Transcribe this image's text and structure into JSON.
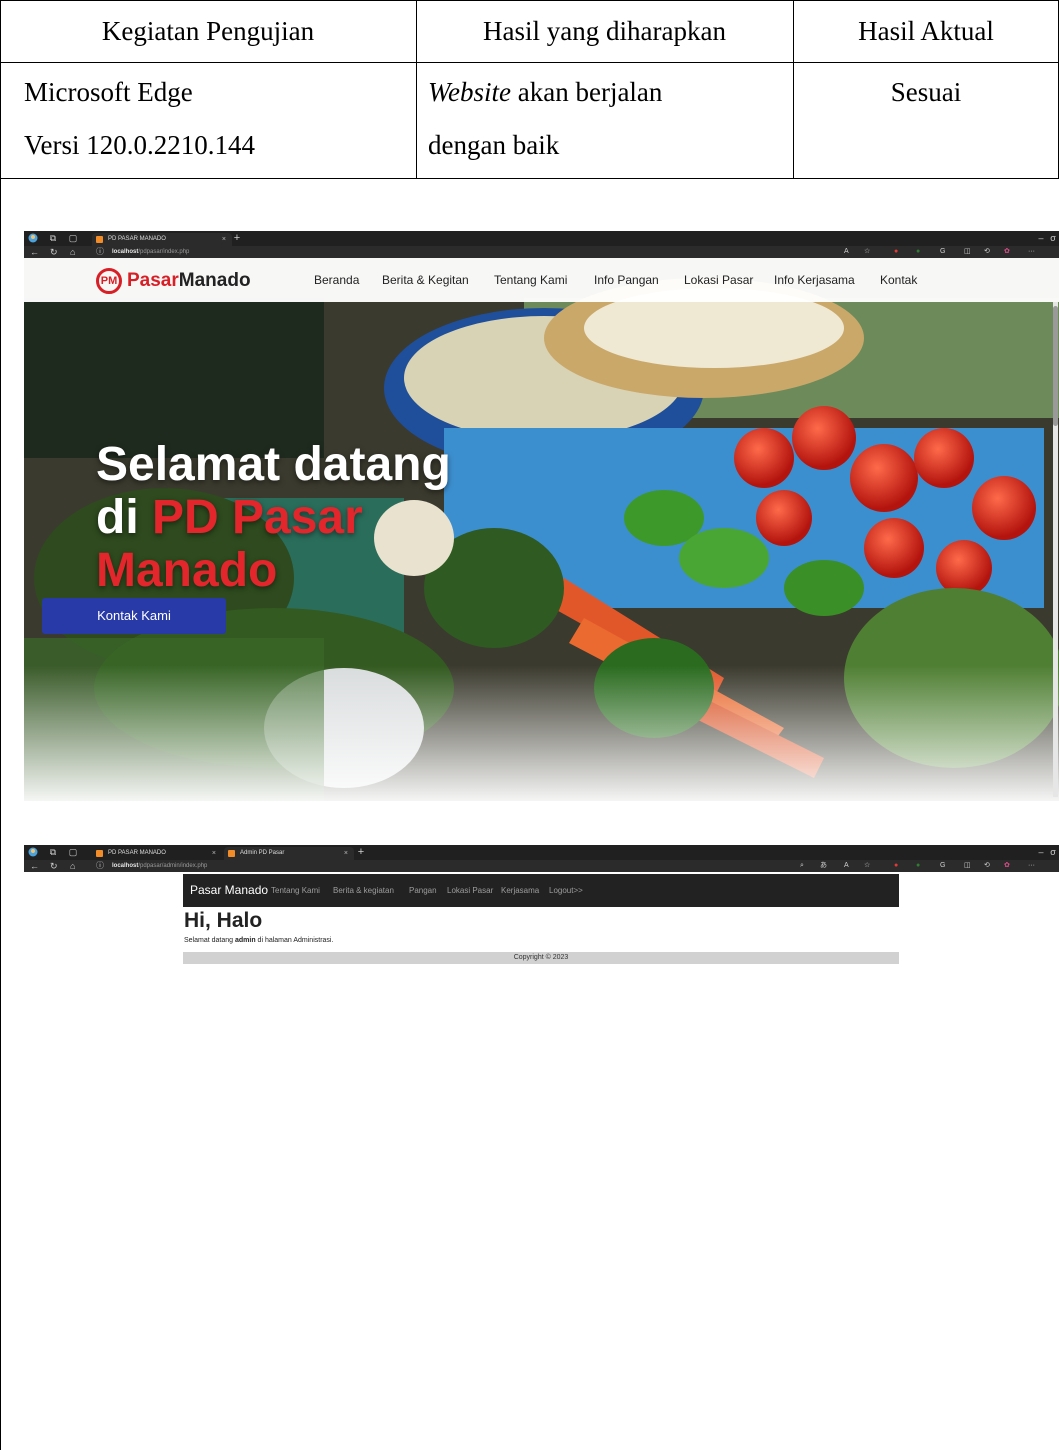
{
  "table": {
    "headers": [
      "Kegiatan Pengujian",
      "Hasil yang diharapkan",
      "Hasil Aktual"
    ],
    "row": {
      "kegiatan_line1": "Microsoft Edge",
      "kegiatan_line2": "Versi 120.0.2210.144",
      "harapan_italic": "Website",
      "harapan_rest": " akan berjalan",
      "harapan_line2": "dengan baik",
      "aktual": "Sesuai"
    }
  },
  "screenshot_public": {
    "tab_title": "PD PASAR MANADO",
    "tab_close": "×",
    "new_tab": "+",
    "url_host": "localhost",
    "url_path": "/pdpasar/index.php",
    "logo_mark": "PM",
    "logo_part1": "Pasar",
    "logo_part2": "Manado",
    "menu": [
      "Beranda",
      "Berita & Kegitan",
      "Tentang Kami",
      "Info Pangan",
      "Lokasi Pasar",
      "Info Kerjasama",
      "Kontak"
    ],
    "hero_line1": "Selamat datang",
    "hero_line2_a": "di ",
    "hero_line2_b": "PD Pasar",
    "hero_line3": "Manado",
    "hero_button": "Kontak Kami"
  },
  "screenshot_admin": {
    "tab1_title": "PD PASAR MANADO",
    "tab2_title": "Admin PD Pasar",
    "tab_close": "×",
    "new_tab": "+",
    "url_host": "localhost",
    "url_path": "/pdpasar/admin/index.php",
    "brand": "Pasar Manado",
    "menu": [
      "Tentang Kami",
      "Berita & kegiatan",
      "Pangan",
      "Lokasi Pasar",
      "Kerjasama",
      "Logout>>"
    ],
    "heading": "Hi, Halo",
    "welcome_before": "Selamat datang ",
    "welcome_bold": "admin",
    "welcome_after": " di halaman Administrasi.",
    "footer": "Copyright © 2023"
  },
  "icons": [
    "edge-profile-icon",
    "workspaces-icon",
    "tab-actions-icon",
    "back-icon",
    "refresh-icon",
    "home-icon",
    "info-icon",
    "read-aloud-icon",
    "favorite-icon",
    "extensions-icon",
    "split-screen-icon",
    "history-icon",
    "copilot-icon",
    "more-icon",
    "minimize-icon"
  ]
}
